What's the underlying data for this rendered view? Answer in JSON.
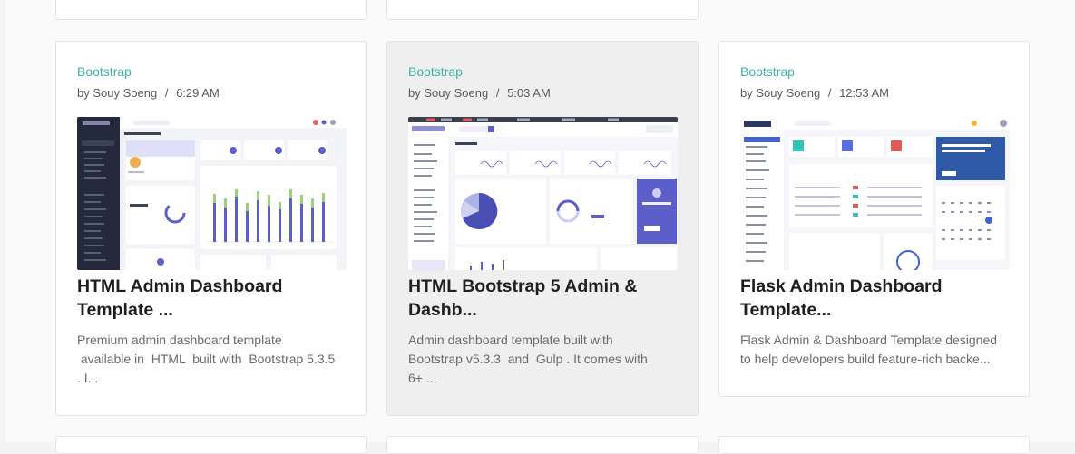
{
  "cards": [
    {
      "category": "Bootstrap",
      "author_prefix": "by",
      "author": "Souy Soeng",
      "separator": "/",
      "time": "6:29 AM",
      "title": "HTML Admin Dashboard Template ...",
      "description": "Premium admin dashboard template\n available in  HTML  built with  Bootstrap 5.3.5\n. I..."
    },
    {
      "category": "Bootstrap",
      "author_prefix": "by",
      "author": "Souy Soeng",
      "separator": "/",
      "time": "5:03 AM",
      "title": "HTML Bootstrap 5 Admin & Dashb...",
      "description": "Admin dashboard template built with\nBootstrap v5.3.3  and  Gulp . It comes with\n6+ ..."
    },
    {
      "category": "Bootstrap",
      "author_prefix": "by",
      "author": "Souy Soeng",
      "separator": "/",
      "time": "12:53 AM",
      "title": "Flask Admin Dashboard Template...",
      "description": "Flask Admin & Dashboard Template designed\nto help developers build feature-rich backe..."
    }
  ],
  "colors": {
    "category": "#3fb4a4",
    "accent_purple": "#5b5fc7",
    "dark_sidebar": "#242a3b"
  }
}
